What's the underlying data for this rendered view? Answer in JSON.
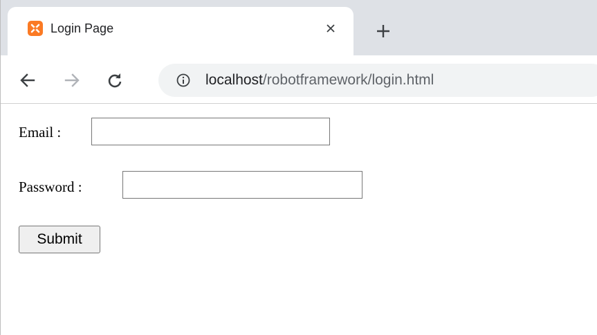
{
  "browser": {
    "tab": {
      "title": "Login Page",
      "close_glyph": "×",
      "favicon": "xampp-icon"
    },
    "new_tab_glyph": "+",
    "nav": {
      "back_icon": "arrow-left-icon",
      "forward_icon": "arrow-right-icon",
      "reload_icon": "reload-icon"
    },
    "address": {
      "info_icon": "info-icon",
      "host": "localhost",
      "path": "/robotframework/login.html"
    },
    "colors": {
      "tabstrip_bg": "#dee1e6",
      "omnibox_bg": "#f1f3f4",
      "favicon_orange": "#fb7a24"
    }
  },
  "page": {
    "email": {
      "label": "Email :",
      "value": "",
      "placeholder": ""
    },
    "password": {
      "label": "Password :",
      "value": "",
      "placeholder": ""
    },
    "submit_label": "Submit"
  }
}
